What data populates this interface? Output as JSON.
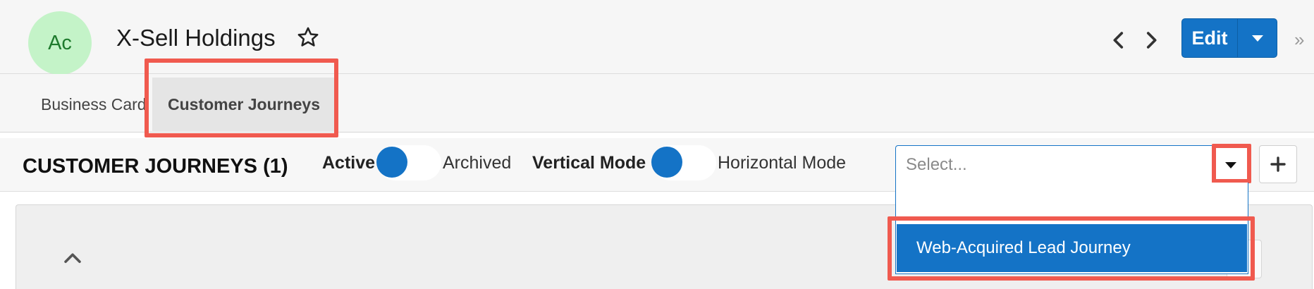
{
  "header": {
    "avatar_text": "Ac",
    "avatar_bg": "#c4f3c8",
    "record_name": "X-Sell Holdings",
    "favorite_icon": "star-outline-icon",
    "prev_icon": "chevron-left-icon",
    "next_icon": "chevron-right-icon",
    "edit_label": "Edit",
    "edit_menu_icon": "caret-down-icon",
    "collapse_label": "»",
    "accent": "#1473c6"
  },
  "tabs": [
    {
      "label": "Business Card",
      "active": false
    },
    {
      "label": "Customer Journeys",
      "active": true
    }
  ],
  "dashlet": {
    "title": "CUSTOMER JOURNEYS (1)",
    "active_label": "Active",
    "archived_label": "Archived",
    "vertical_label": "Vertical Mode",
    "horizontal_label": "Horizontal Mode",
    "select_placeholder": "Select...",
    "add_icon": "plus-icon",
    "options": [
      {
        "label": "",
        "highlighted": false
      },
      {
        "label": "Web-Acquired Lead Journey",
        "highlighted": true
      }
    ]
  },
  "annotation_color": "#f05a4f"
}
